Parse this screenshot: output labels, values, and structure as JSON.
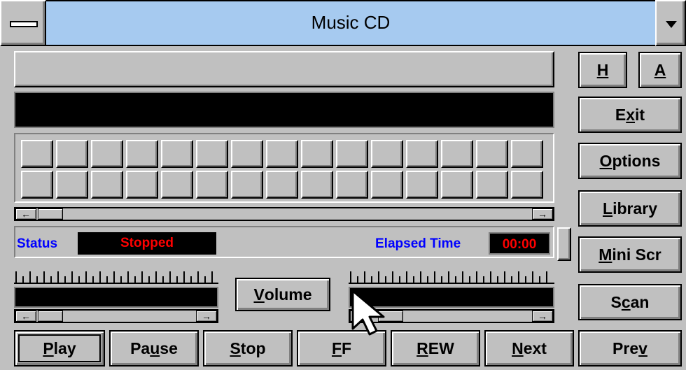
{
  "window": {
    "title": "Music CD"
  },
  "status": {
    "label": "Status",
    "value": "Stopped"
  },
  "elapsed": {
    "label": "Elapsed Time",
    "value": "00:00"
  },
  "volume": {
    "label_pre": "",
    "label_u": "V",
    "label_post": "olume"
  },
  "side": {
    "h": {
      "u": "H",
      "post": ""
    },
    "a": {
      "u": "A",
      "post": ""
    },
    "exit": {
      "pre": "E",
      "u": "x",
      "post": "it"
    },
    "options": {
      "pre": "",
      "u": "O",
      "post": "ptions"
    },
    "library": {
      "pre": "",
      "u": "L",
      "post": "ibrary"
    },
    "mini": {
      "pre": "",
      "u": "M",
      "post": "ini Scr"
    },
    "scan": {
      "pre": "S",
      "u": "c",
      "post": "an"
    }
  },
  "transport": [
    {
      "name": "play-button",
      "pre": "",
      "u": "P",
      "post": "lay"
    },
    {
      "name": "pause-button",
      "pre": "Pa",
      "u": "u",
      "post": "se"
    },
    {
      "name": "stop-button",
      "pre": "",
      "u": "S",
      "post": "top"
    },
    {
      "name": "ff-button",
      "pre": "",
      "u": "F",
      "post": "F"
    },
    {
      "name": "rew-button",
      "pre": "",
      "u": "R",
      "post": "EW"
    },
    {
      "name": "next-button",
      "pre": "",
      "u": "N",
      "post": "ext"
    },
    {
      "name": "prev-button",
      "pre": "Pre",
      "u": "v",
      "post": ""
    }
  ],
  "icons": {
    "left": "left-arrow-icon",
    "right": "right-arrow-icon",
    "cursor": "mouse-pointer-icon"
  },
  "colors": {
    "titlebar": "#a6caf0",
    "face": "#c0c0c0",
    "status_red": "#ff0000",
    "label_blue": "#0000ff"
  }
}
